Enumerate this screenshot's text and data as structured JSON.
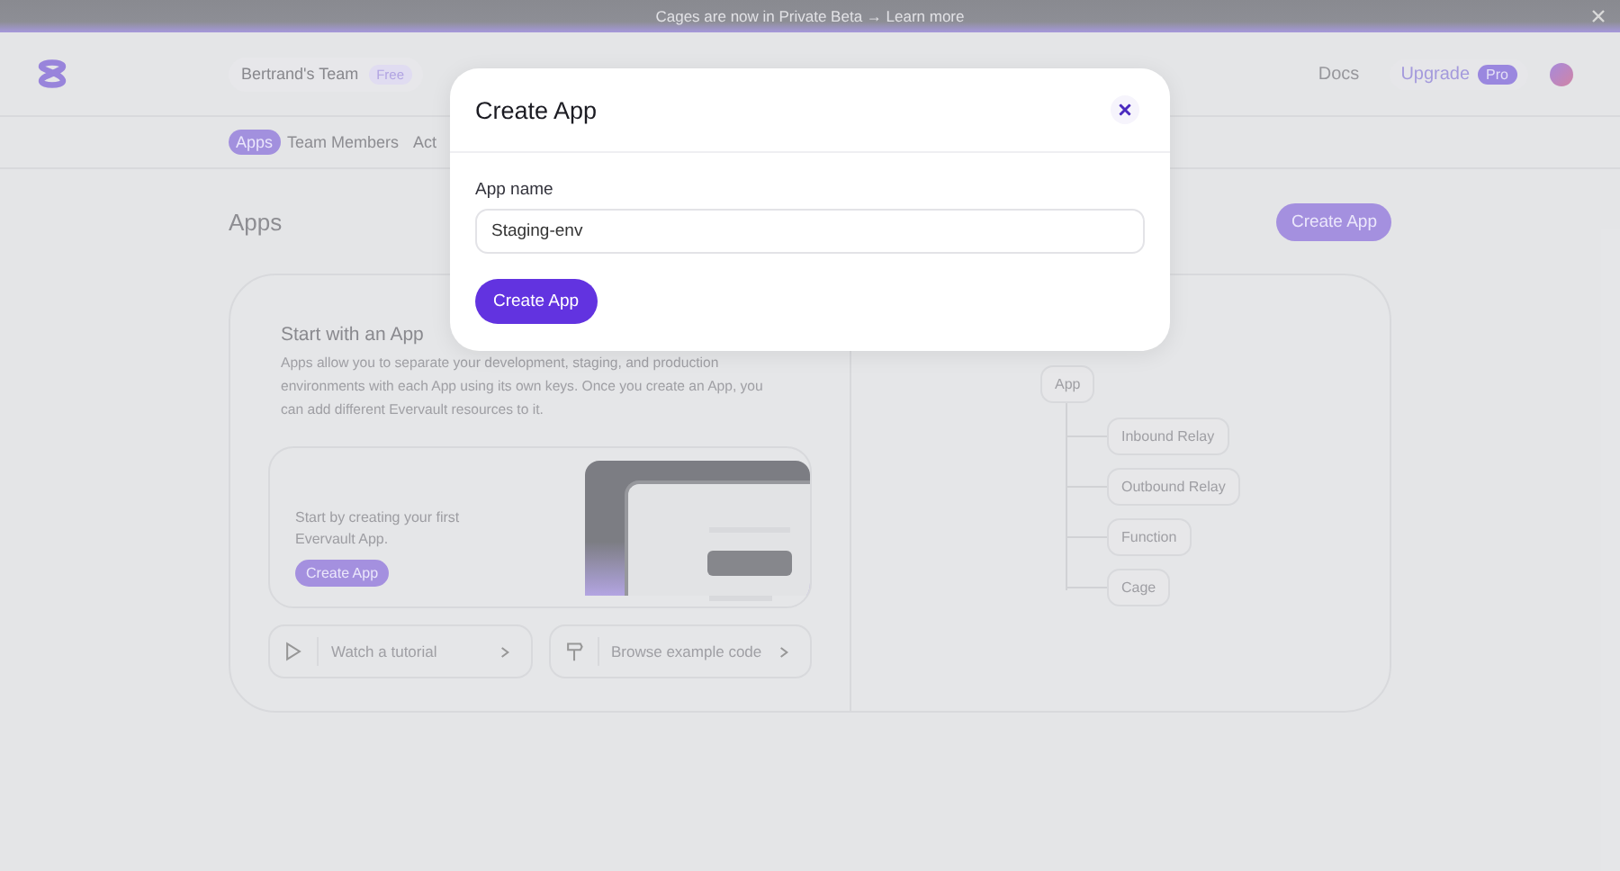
{
  "banner": {
    "text": "Cages are now in Private Beta → Learn more"
  },
  "header": {
    "team": {
      "name": "Bertrand's Team",
      "plan": "Free"
    },
    "docs": "Docs",
    "upgrade": {
      "label": "Upgrade",
      "plan": "Pro"
    }
  },
  "tabs": [
    {
      "label": "Apps",
      "selected": true
    },
    {
      "label": "Team Members",
      "selected": false
    },
    {
      "label": "Act",
      "selected": false
    }
  ],
  "page": {
    "title": "Apps",
    "create_button": "Create App"
  },
  "intro": {
    "title": "Start with an App",
    "description": "Apps allow you to separate your development, staging, and production environments with each App using its own keys. Once you create an App, you can add different Evervault resources to it.",
    "prompt": "Start by creating your first Evervault App.",
    "prompt_button": "Create App",
    "links": [
      {
        "kind": "video",
        "label": "Watch a tutorial"
      },
      {
        "kind": "code",
        "label": "Browse example code"
      }
    ]
  },
  "tree": {
    "label": "App",
    "children": [
      {
        "label": "Inbound Relay"
      },
      {
        "label": "Outbound Relay"
      },
      {
        "label": "Function"
      },
      {
        "label": "Cage"
      }
    ]
  },
  "modal": {
    "title": "Create App",
    "field_label": "App name",
    "field_value": "Staging-env",
    "submit": "Create App"
  }
}
